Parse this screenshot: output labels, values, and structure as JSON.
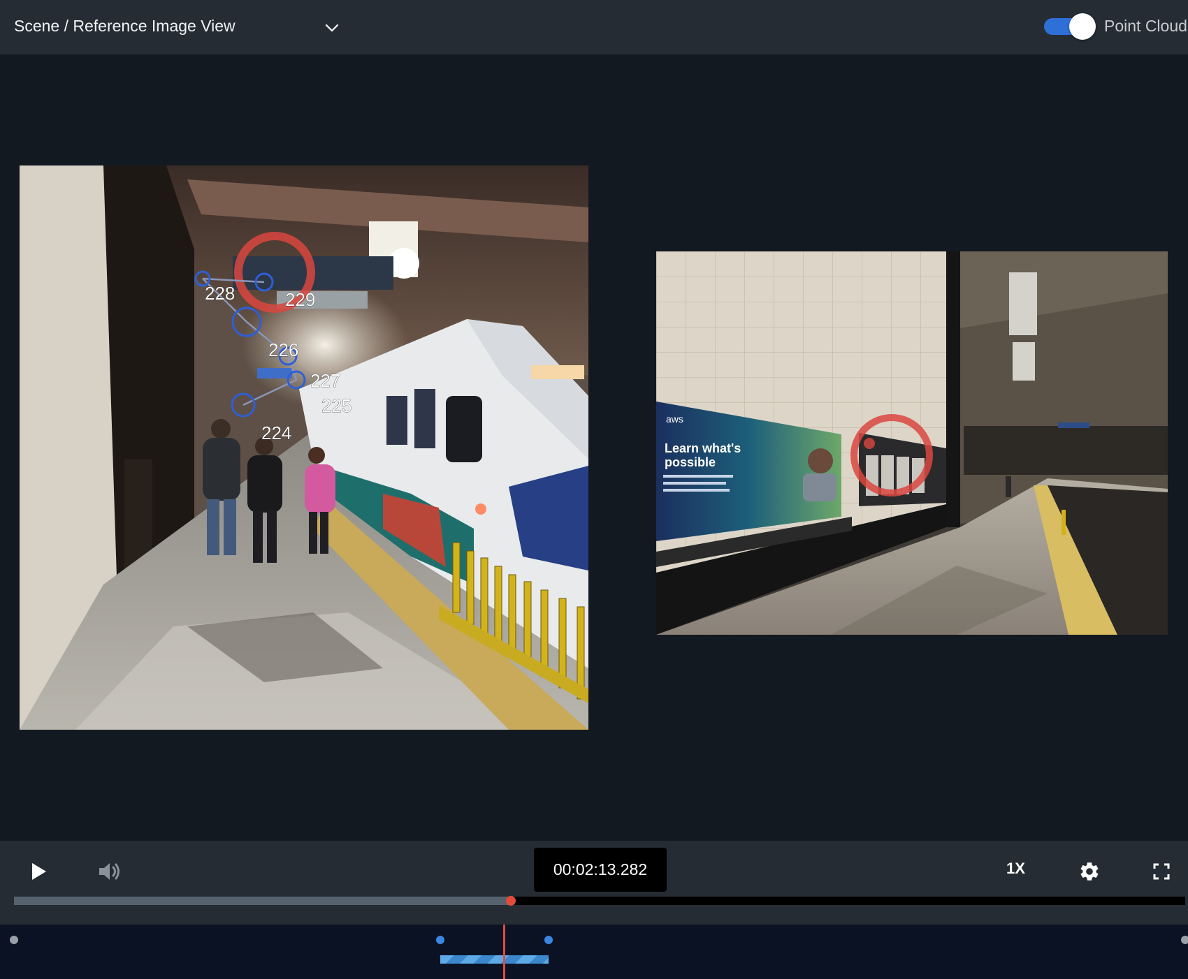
{
  "header": {
    "view_title": "Scene / Reference Image View",
    "point_cloud_label": "Point Cloud",
    "point_cloud_enabled": true
  },
  "scene_image": {
    "keypoints": [
      "224",
      "225",
      "226",
      "227",
      "228",
      "229"
    ]
  },
  "reference_image": {
    "poster_brand": "aws",
    "poster_headline_1": "Learn what's",
    "poster_headline_2": "possible"
  },
  "player": {
    "timecode": "00:02:13.282",
    "playback_speed": "1X",
    "progress_fraction": 0.4244,
    "icons": {
      "play": "play-icon",
      "volume": "volume-icon",
      "settings": "gear-icon",
      "fullscreen": "fullscreen-icon"
    }
  },
  "timeline": {
    "playhead_fraction": 0.4244,
    "segment_start_fraction": 0.3705,
    "segment_end_fraction": 0.4615
  },
  "colors": {
    "accent_blue": "#2f6fd8",
    "playhead_red": "#e24a3b",
    "marker_red": "#d9473f",
    "keypoint_blue": "#2e5fd6"
  }
}
